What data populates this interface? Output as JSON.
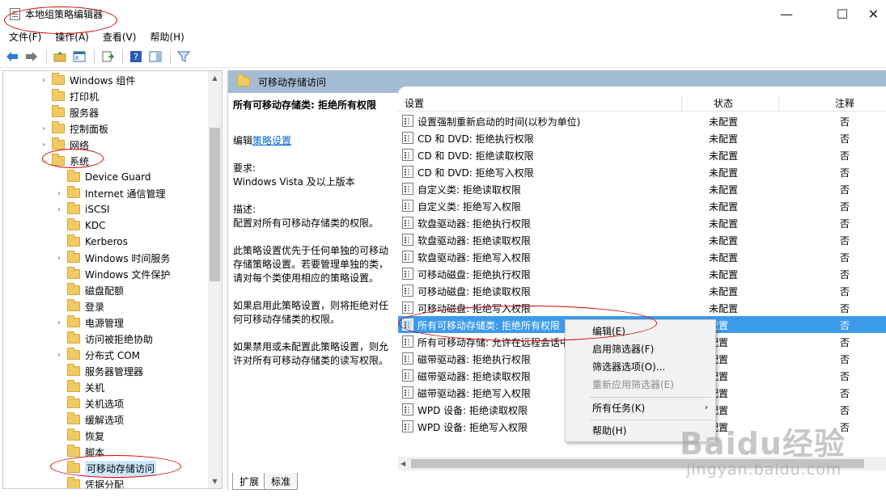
{
  "window": {
    "title": "本地组策略编辑器",
    "controls": {
      "minimize": "—",
      "maximize": "☐",
      "close": "✕"
    }
  },
  "menu": [
    "文件(F)",
    "操作(A)",
    "查看(V)",
    "帮助(H)"
  ],
  "toolbar": {
    "back_icon": "back-arrow-icon",
    "forward_icon": "forward-arrow-icon",
    "up_icon": "up-folder-icon",
    "view_icon": "console-tree-icon",
    "export_icon": "export-list-icon",
    "help_icon": "help-icon",
    "pane_icon": "action-pane-icon",
    "filter_icon": "filter-icon"
  },
  "tree": [
    {
      "label": "Windows 组件",
      "expandable": true,
      "level": 2
    },
    {
      "label": "打印机",
      "expandable": false,
      "level": 2
    },
    {
      "label": "服务器",
      "expandable": false,
      "level": 2
    },
    {
      "label": "控制面板",
      "expandable": true,
      "level": 2
    },
    {
      "label": "网络",
      "expandable": true,
      "level": 2
    },
    {
      "label": "系统",
      "expandable": true,
      "expanded": true,
      "level": 2
    },
    {
      "label": "Device Guard",
      "expandable": false,
      "level": 3
    },
    {
      "label": "Internet 通信管理",
      "expandable": true,
      "level": 3
    },
    {
      "label": "iSCSI",
      "expandable": true,
      "level": 3
    },
    {
      "label": "KDC",
      "expandable": false,
      "level": 3
    },
    {
      "label": "Kerberos",
      "expandable": false,
      "level": 3
    },
    {
      "label": "Windows 时间服务",
      "expandable": true,
      "level": 3
    },
    {
      "label": "Windows 文件保护",
      "expandable": false,
      "level": 3
    },
    {
      "label": "磁盘配额",
      "expandable": false,
      "level": 3
    },
    {
      "label": "登录",
      "expandable": false,
      "level": 3
    },
    {
      "label": "电源管理",
      "expandable": true,
      "level": 3
    },
    {
      "label": "访问被拒绝协助",
      "expandable": false,
      "level": 3
    },
    {
      "label": "分布式 COM",
      "expandable": true,
      "level": 3
    },
    {
      "label": "服务器管理器",
      "expandable": false,
      "level": 3
    },
    {
      "label": "关机",
      "expandable": false,
      "level": 3
    },
    {
      "label": "关机选项",
      "expandable": false,
      "level": 3
    },
    {
      "label": "缓解选项",
      "expandable": false,
      "level": 3
    },
    {
      "label": "恢复",
      "expandable": false,
      "level": 3
    },
    {
      "label": "脚本",
      "expandable": false,
      "level": 3
    },
    {
      "label": "可移动存储访问",
      "expandable": false,
      "level": 3,
      "selected": true
    },
    {
      "label": "凭据分配",
      "expandable": false,
      "level": 3
    }
  ],
  "right": {
    "header_title": "可移动存储访问",
    "description": {
      "title": "所有可移动存储类: 拒绝所有权限",
      "edit_prefix": "编辑",
      "edit_link": "策略设置",
      "req_label": "要求:",
      "req_value": "Windows Vista 及以上版本",
      "desc_label": "描述:",
      "desc_value": "配置对所有可移动存储类的权限。",
      "p1": "此策略设置优先于任何单独的可移动存储策略设置。若要管理单独的类，请对每个类使用相应的策略设置。",
      "p2": "如果启用此策略设置，则将拒绝对任何可移动存储类的权限。",
      "p3": "如果禁用或未配置此策略设置，则允许对所有可移动存储类的读写权限。"
    },
    "columns": {
      "setting": "设置",
      "status": "状态",
      "note": "注释"
    },
    "rows": [
      {
        "name": "设置强制重新启动的时间(以秒为单位)",
        "state": "未配置",
        "note": "否"
      },
      {
        "name": "CD 和 DVD: 拒绝执行权限",
        "state": "未配置",
        "note": "否"
      },
      {
        "name": "CD 和 DVD: 拒绝读取权限",
        "state": "未配置",
        "note": "否"
      },
      {
        "name": "CD 和 DVD: 拒绝写入权限",
        "state": "未配置",
        "note": "否"
      },
      {
        "name": "自定义类: 拒绝读取权限",
        "state": "未配置",
        "note": "否"
      },
      {
        "name": "自定义类: 拒绝写入权限",
        "state": "未配置",
        "note": "否"
      },
      {
        "name": "软盘驱动器: 拒绝执行权限",
        "state": "未配置",
        "note": "否"
      },
      {
        "name": "软盘驱动器: 拒绝读取权限",
        "state": "未配置",
        "note": "否"
      },
      {
        "name": "软盘驱动器: 拒绝写入权限",
        "state": "未配置",
        "note": "否"
      },
      {
        "name": "可移动磁盘: 拒绝执行权限",
        "state": "未配置",
        "note": "否"
      },
      {
        "name": "可移动磁盘: 拒绝读取权限",
        "state": "未配置",
        "note": "否"
      },
      {
        "name": "可移动磁盘: 拒绝写入权限",
        "state": "未配置",
        "note": "否"
      },
      {
        "name": "所有可移动存储类: 拒绝所有权限",
        "state": "配置",
        "note": "否",
        "selected": true
      },
      {
        "name": "所有可移动存储: 允许在远程会话中",
        "state": "配置",
        "note": "否"
      },
      {
        "name": "磁带驱动器: 拒绝执行权限",
        "state": "配置",
        "note": "否"
      },
      {
        "name": "磁带驱动器: 拒绝读取权限",
        "state": "配置",
        "note": "否"
      },
      {
        "name": "磁带驱动器: 拒绝写入权限",
        "state": "配置",
        "note": "否"
      },
      {
        "name": "WPD 设备: 拒绝读取权限",
        "state": "配置",
        "note": "否"
      },
      {
        "name": "WPD 设备: 拒绝写入权限",
        "state": "配置",
        "note": "否"
      }
    ],
    "tabs": {
      "extended": "扩展",
      "standard": "标准"
    }
  },
  "context_menu": {
    "edit": "编辑(E)",
    "enable_filter": "启用筛选器(F)",
    "filter_options": "筛选器选项(O)...",
    "reapply_filter": "重新应用筛选器(E)",
    "all_tasks": "所有任务(K)",
    "help": "帮助(H)",
    "submenu_arrow": "›"
  },
  "watermark": {
    "main": "Baidu经验",
    "sub": "jingyan.baidu.com"
  },
  "colors": {
    "selection": "#3b9bea",
    "header": "#a4bcd3",
    "annotation": "#d40000"
  }
}
